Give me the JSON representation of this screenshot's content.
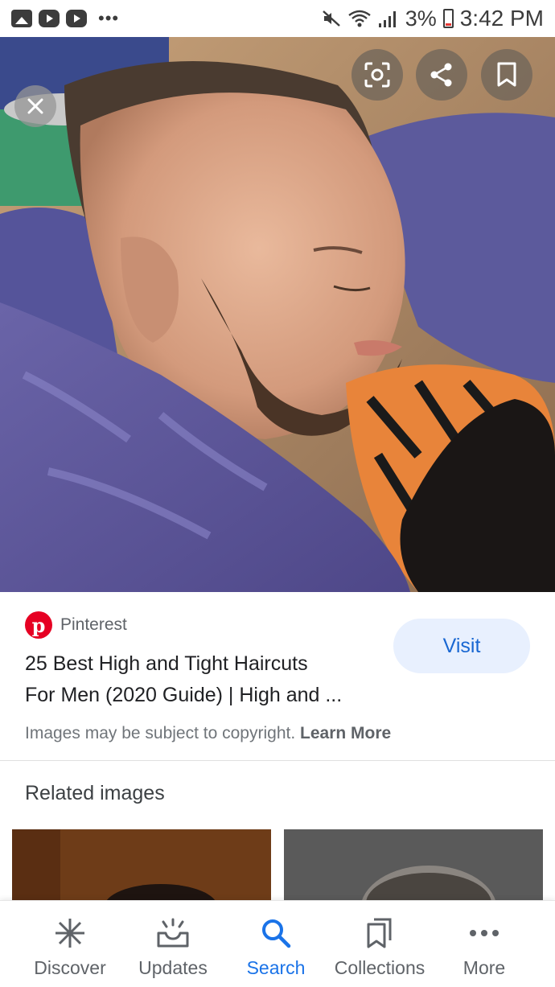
{
  "status_bar": {
    "battery": "3%",
    "time": "3:42 PM",
    "icons": [
      "gallery-icon",
      "youtube-icon",
      "youtube-icon",
      "more-dots-icon",
      "mute-icon",
      "wifi-icon",
      "signal-icon",
      "battery-icon"
    ]
  },
  "image_viewer": {
    "close_icon": "close-icon",
    "actions": [
      "lens-icon",
      "share-icon",
      "bookmark-icon"
    ]
  },
  "result": {
    "source": "Pinterest",
    "title_line1": "25 Best High and Tight Haircuts",
    "title_line2": "For Men (2020 Guide) | High and ...",
    "visit_label": "Visit",
    "copyright_text": "Images may be subject to copyright.",
    "learn_more": "Learn More"
  },
  "related": {
    "title": "Related images"
  },
  "bottom_nav": {
    "items": [
      {
        "label": "Discover",
        "icon": "asterisk-icon"
      },
      {
        "label": "Updates",
        "icon": "updates-icon"
      },
      {
        "label": "Search",
        "icon": "search-icon"
      },
      {
        "label": "Collections",
        "icon": "collections-icon"
      },
      {
        "label": "More",
        "icon": "more-icon"
      }
    ],
    "active": "Search"
  },
  "colors": {
    "accent": "#1a73e8",
    "visit_bg": "#e8f0fe",
    "pinterest": "#e60023"
  }
}
